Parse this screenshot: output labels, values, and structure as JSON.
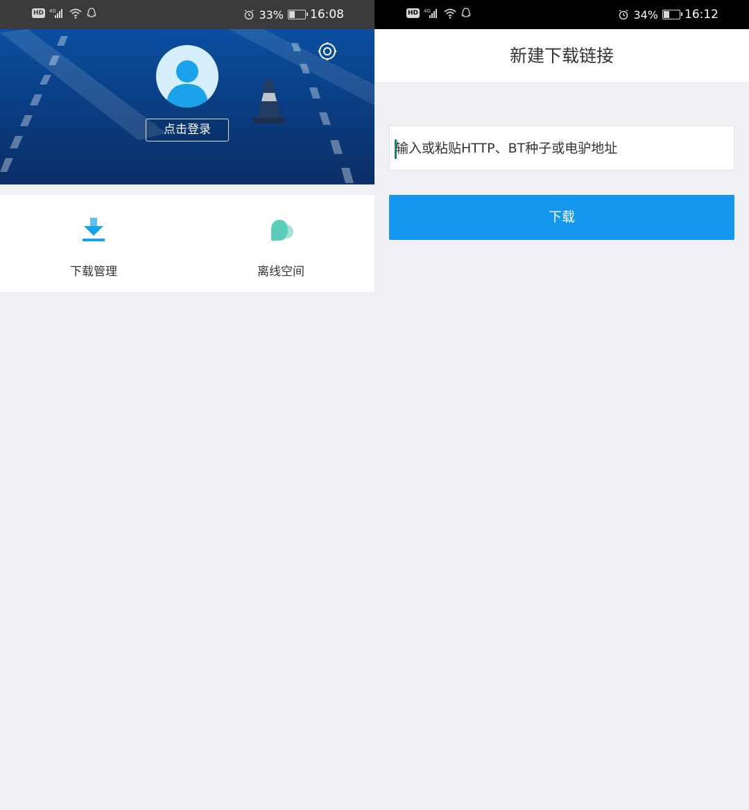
{
  "left_screen": {
    "status": {
      "battery_percent": "33%",
      "time": "16:08",
      "battery_level": 0.33
    },
    "header": {
      "login_label": "点击登录"
    },
    "menu": {
      "items": [
        {
          "label": "下载管理",
          "icon": "download-icon"
        },
        {
          "label": "离线空间",
          "icon": "cloud-icon"
        }
      ]
    }
  },
  "right_screen": {
    "status": {
      "battery_percent": "34%",
      "time": "16:12",
      "battery_level": 0.34
    },
    "title": "新建下载链接",
    "url_input": {
      "value": "",
      "placeholder": "输入或粘贴HTTP、BT种子或电驴地址"
    },
    "download_label": "下载"
  },
  "colors": {
    "accent": "#1597f0",
    "icon_blue": "#1aa3e8",
    "icon_teal": "#5ccdbb",
    "background": "#eef0f3"
  }
}
